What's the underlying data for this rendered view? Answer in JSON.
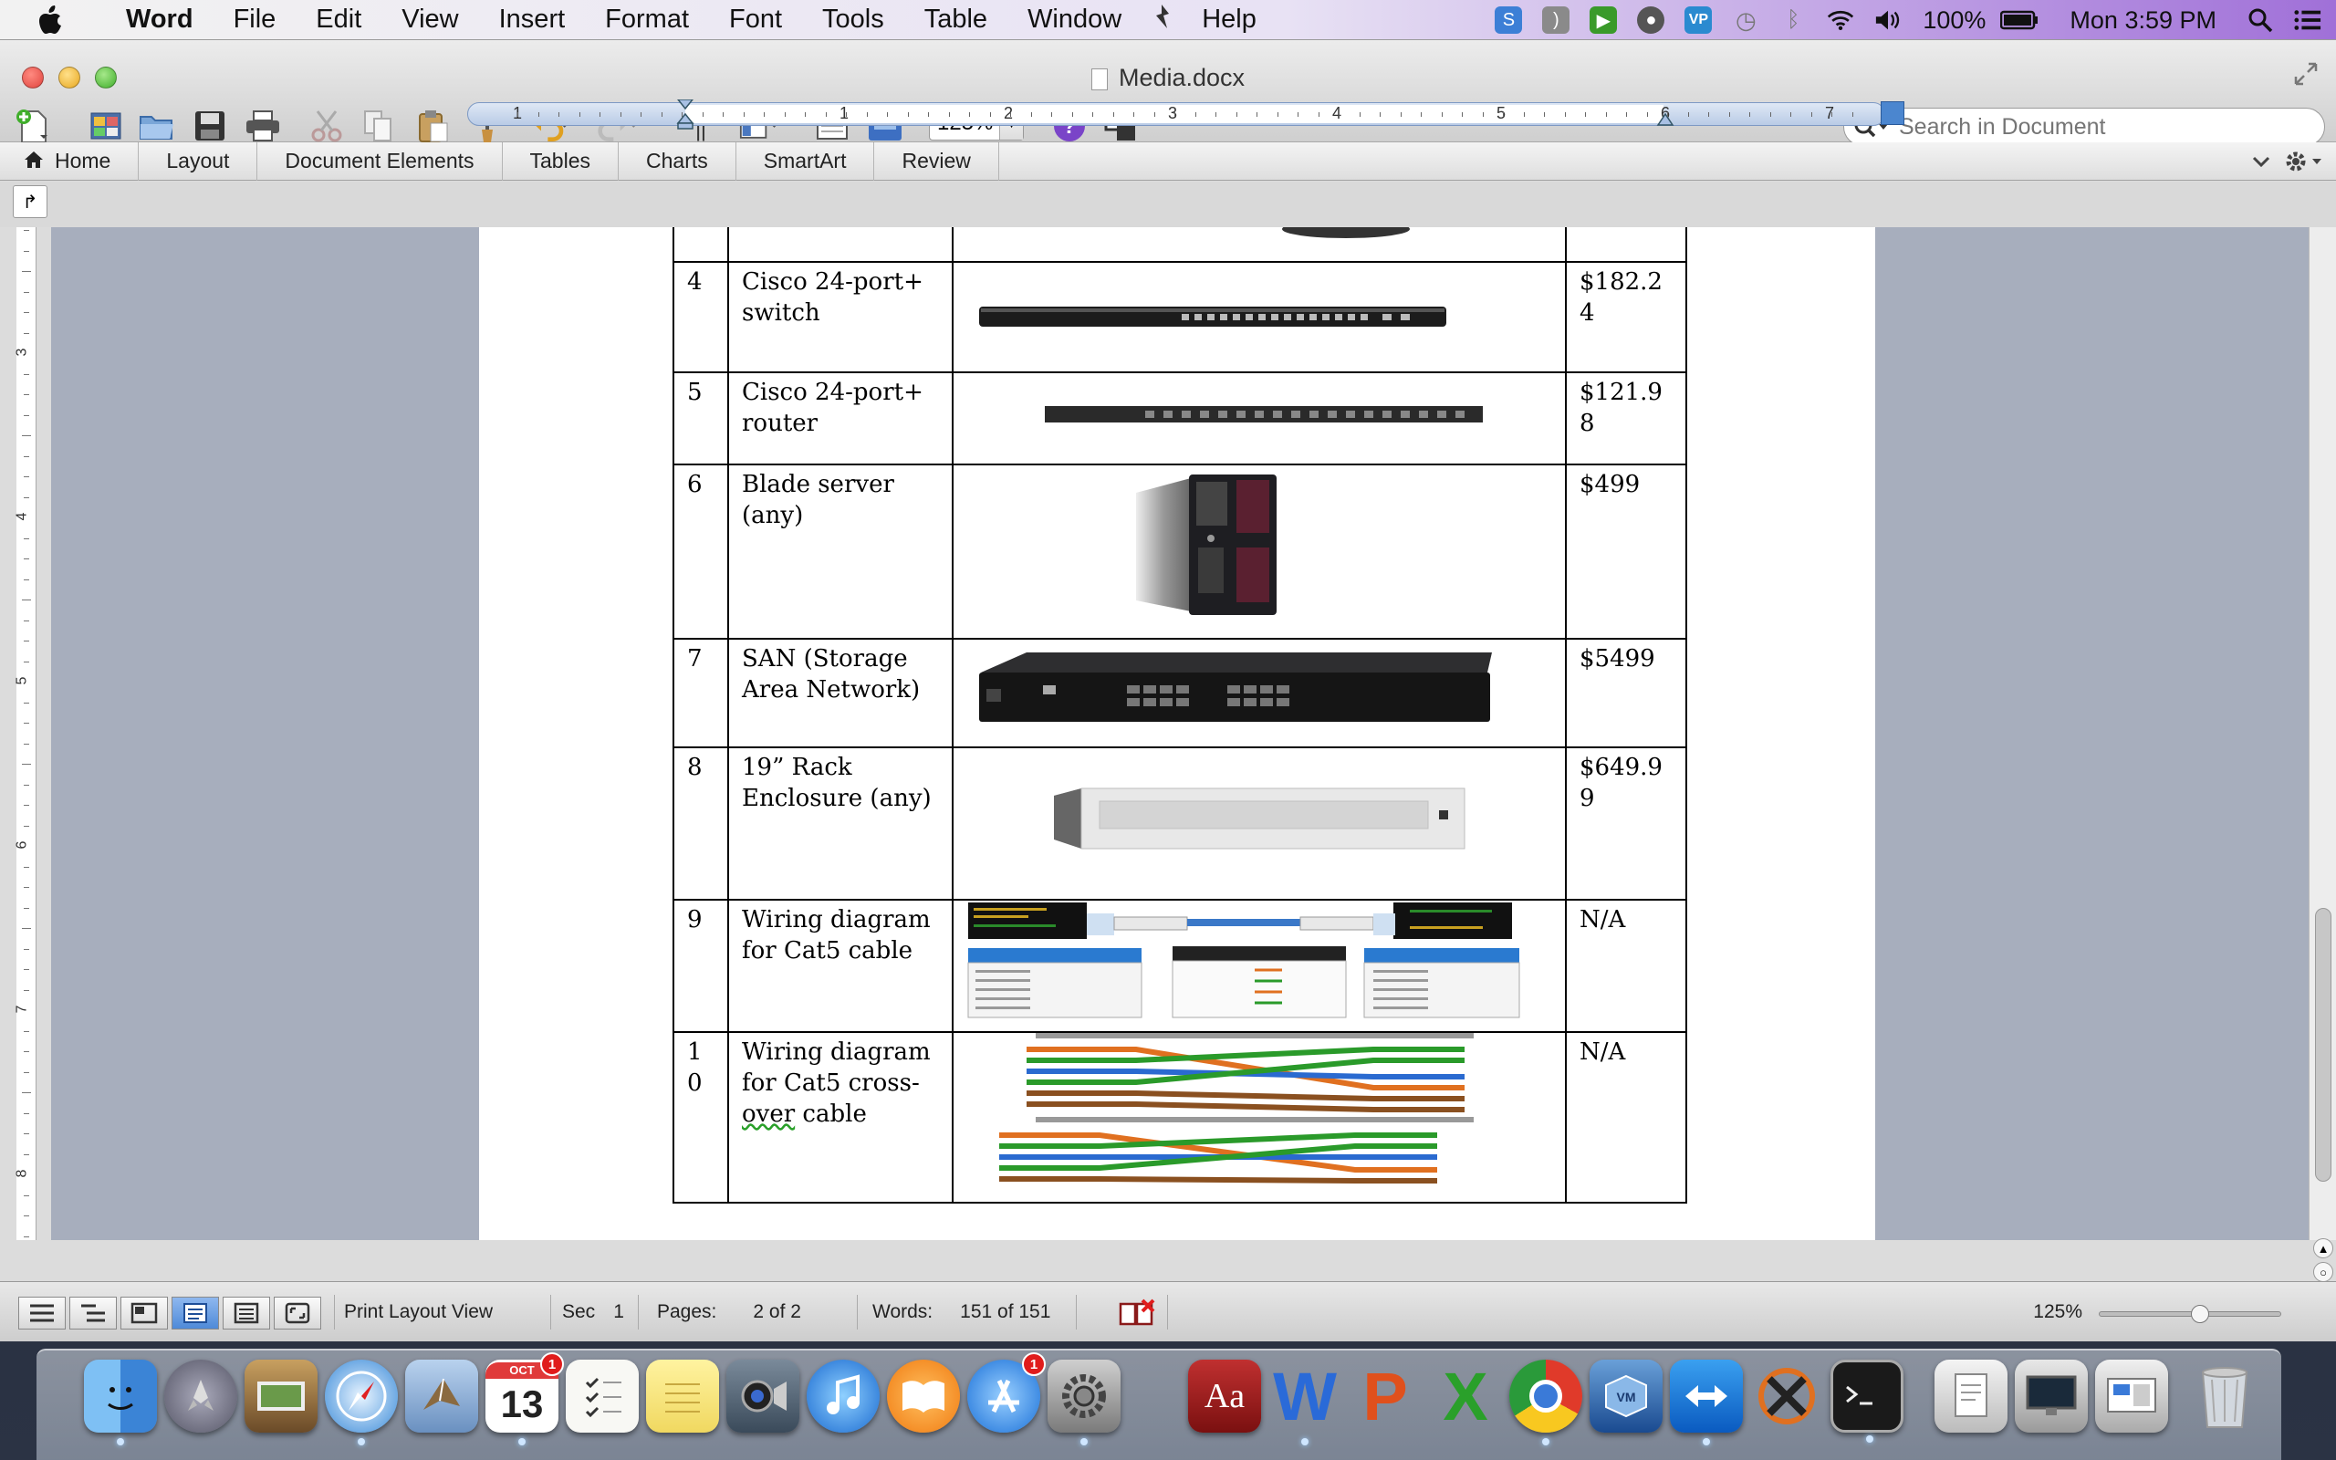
{
  "menubar": {
    "app": "Word",
    "items": [
      "File",
      "Edit",
      "View",
      "Insert",
      "Format",
      "Font",
      "Tools",
      "Table",
      "Window",
      "Help"
    ],
    "battery": "100%",
    "clock": "Mon 3:59 PM"
  },
  "window": {
    "title": "Media.docx",
    "zoom": "125%",
    "search_placeholder": "Search in Document"
  },
  "ribbon": {
    "tabs": [
      "Home",
      "Layout",
      "Document Elements",
      "Tables",
      "Charts",
      "SmartArt",
      "Review"
    ]
  },
  "ruler": {
    "labels": [
      "1",
      "1",
      "2",
      "3",
      "4",
      "5",
      "6",
      "7"
    ]
  },
  "table": {
    "rows": [
      {
        "num": "4",
        "desc": "Cisco 24-port+ switch",
        "image": "cisco-switch-image",
        "price": "$182.24"
      },
      {
        "num": "5",
        "desc": "Cisco 24-port+ router",
        "image": "cisco-router-image",
        "price": "$121.98"
      },
      {
        "num": "6",
        "desc": "Blade server (any)",
        "image": "blade-server-image",
        "price": "$499"
      },
      {
        "num": "7",
        "desc": "SAN (Storage Area Network)",
        "image": "san-device-image",
        "price": "$5499"
      },
      {
        "num": "8",
        "desc": "19” Rack Enclosure (any)",
        "image": "rack-enclosure-image",
        "price": "$649.99"
      },
      {
        "num": "9",
        "desc": "Wiring diagram for Cat5 cable",
        "image": "cat5-wiring-diagram",
        "price": "N/A"
      },
      {
        "num": "10",
        "desc_line1": "Wiring diagram for Cat5 cross-",
        "desc_line2": "over",
        "desc_line3": " cable",
        "image": "cat5-crossover-diagram",
        "price": "N/A"
      }
    ]
  },
  "statusbar": {
    "view": "Print Layout View",
    "sec_label": "Sec",
    "sec_value": "1",
    "pages_label": "Pages:",
    "pages_value": "2 of 2",
    "words_label": "Words:",
    "words_value": "151 of 151",
    "zoom": "125%"
  },
  "dock": {
    "calendar_month": "OCT",
    "calendar_day": "13",
    "calendar_badge": "1",
    "appstore_badge": "1",
    "items": [
      "finder",
      "launchpad",
      "image-capture",
      "safari",
      "mail",
      "calendar",
      "reminders",
      "notes",
      "facetime",
      "itunes",
      "ibooks",
      "app-store",
      "system-preferences",
      "dictionary",
      "word",
      "powerpoint",
      "excel",
      "chrome",
      "virtualbox",
      "teamviewer",
      "x11",
      "terminal",
      "preview",
      "screen-sharing",
      "network-utility",
      "trash"
    ]
  },
  "colors": {
    "menubar_purple": "#a070d8",
    "page": "#ffffff",
    "doc_background": "#a7aebd",
    "selected_view": "#4e8ad8"
  }
}
